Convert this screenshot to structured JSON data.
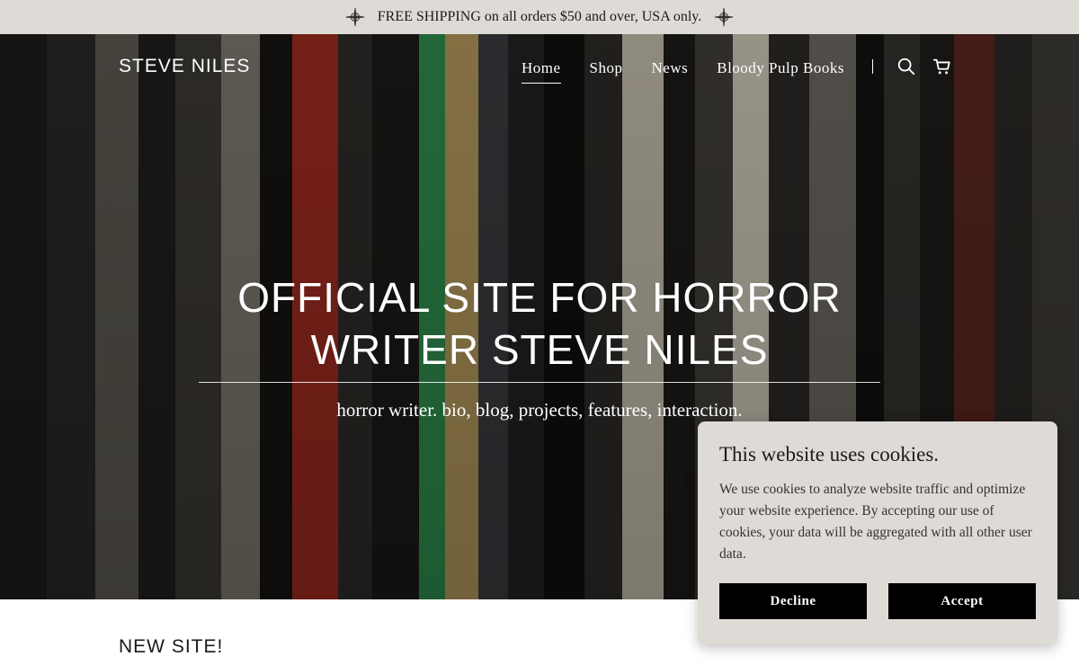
{
  "announcement": {
    "text": "FREE SHIPPING on all orders $50 and over, USA only.",
    "ornament_icon": "compass-star-icon"
  },
  "header": {
    "site_title": "STEVE NILES",
    "nav": [
      {
        "label": "Home",
        "active": true
      },
      {
        "label": "Shop",
        "active": false
      },
      {
        "label": "News",
        "active": false
      },
      {
        "label": "Bloody Pulp Books",
        "active": false
      }
    ],
    "icons": [
      "search-icon",
      "cart-icon"
    ]
  },
  "hero": {
    "title_line1": "OFFICIAL SITE FOR HORROR",
    "title_line2": "WRITER STEVE NILES",
    "subtitle": "horror writer. bio, blog, projects, features, interaction."
  },
  "content": {
    "section_title": "NEW SITE!"
  },
  "cookie_banner": {
    "title": "This website uses cookies.",
    "body": "We use cookies to analyze website traffic and optimize your website experience. By accepting our use of cookies, your data will be aggregated with all other user data.",
    "decline_label": "Decline",
    "accept_label": "Accept"
  },
  "colors": {
    "announcement_bg": "#dedbd6",
    "cookie_bg": "#dedbd6",
    "button_bg": "#000000",
    "hero_text": "#ffffff"
  }
}
